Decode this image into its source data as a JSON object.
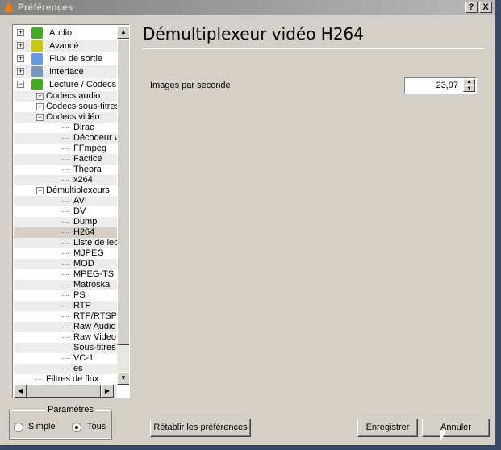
{
  "window": {
    "title": "Préférences",
    "help": "?",
    "close": "X"
  },
  "tree": [
    {
      "label": "Audio",
      "level": 0,
      "exp": "+",
      "icon": "music-note-icon",
      "color": "#44aa22"
    },
    {
      "label": "Avancé",
      "level": 0,
      "exp": "+",
      "icon": "chip-icon",
      "color": "#c8c800"
    },
    {
      "label": "Flux de sortie",
      "level": 0,
      "exp": "+",
      "icon": "stream-output-icon",
      "color": "#6699dd"
    },
    {
      "label": "Interface",
      "level": 0,
      "exp": "+",
      "icon": "interface-icon",
      "color": "#7799bb"
    },
    {
      "label": "Lecture / Codecs",
      "level": 0,
      "exp": "-",
      "icon": "codecs-icon",
      "color": "#44aa22"
    },
    {
      "label": "Codecs audio",
      "level": 1,
      "exp": "+"
    },
    {
      "label": "Codecs sous-titres",
      "level": 1,
      "exp": "+"
    },
    {
      "label": "Codecs vidéo",
      "level": 1,
      "exp": "-"
    },
    {
      "label": "Dirac",
      "level": 2
    },
    {
      "label": "Décodeur vidéo",
      "level": 2
    },
    {
      "label": "FFmpeg",
      "level": 2
    },
    {
      "label": "Factice",
      "level": 2
    },
    {
      "label": "Theora",
      "level": 2
    },
    {
      "label": "x264",
      "level": 2
    },
    {
      "label": "Démultiplexeurs",
      "level": 1,
      "exp": "-"
    },
    {
      "label": "AVI",
      "level": 2
    },
    {
      "label": "DV",
      "level": 2
    },
    {
      "label": "Dump",
      "level": 2
    },
    {
      "label": "H264",
      "level": 2,
      "selected": true
    },
    {
      "label": "Liste de lecture",
      "level": 2
    },
    {
      "label": "MJPEG",
      "level": 2
    },
    {
      "label": "MOD",
      "level": 2
    },
    {
      "label": "MPEG-TS",
      "level": 2
    },
    {
      "label": "Matroska",
      "level": 2
    },
    {
      "label": "PS",
      "level": 2
    },
    {
      "label": "RTP",
      "level": 2
    },
    {
      "label": "RTP/RTSP",
      "level": 2
    },
    {
      "label": "Raw Audio",
      "level": 2
    },
    {
      "label": "Raw Video",
      "level": 2
    },
    {
      "label": "Sous-titres",
      "level": 2
    },
    {
      "label": "VC-1",
      "level": 2
    },
    {
      "label": "es",
      "level": 2
    },
    {
      "label": "Filtres de flux",
      "level": 1
    }
  ],
  "params": {
    "title": "Paramètres",
    "simple": "Simple",
    "all": "Tous",
    "selected": "Tous"
  },
  "panel": {
    "title": "Démultiplexeur vidéo H264",
    "fps_label": "Images par seconde",
    "fps_value": "23,97"
  },
  "buttons": {
    "reset": "Rétablir les préférences",
    "save": "Enregistrer",
    "cancel": "Annuler"
  }
}
